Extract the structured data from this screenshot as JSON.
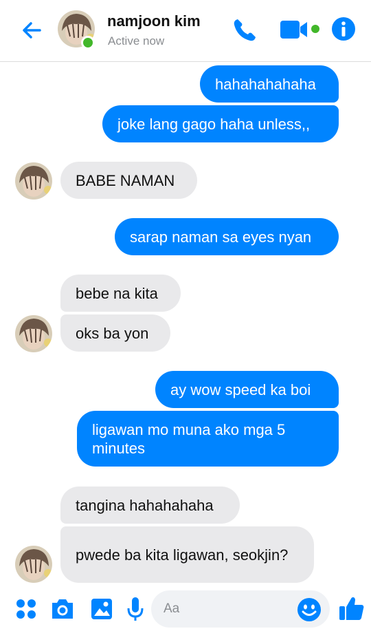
{
  "header": {
    "contact_name": "namjoon kim",
    "status": "Active now",
    "accent": "#0084ff",
    "online_color": "#42b72a",
    "icons": [
      "back-arrow-icon",
      "phone-icon",
      "video-camera-icon",
      "info-icon"
    ]
  },
  "messages": [
    {
      "from": "me",
      "text": "hahahahahaha"
    },
    {
      "from": "me",
      "text": "joke lang gago haha unless,,"
    },
    {
      "from": "them",
      "text": "BABE NAMAN"
    },
    {
      "from": "me",
      "text": "sarap naman sa eyes nyan"
    },
    {
      "from": "them",
      "text": "bebe na kita"
    },
    {
      "from": "them",
      "text": "oks ba yon"
    },
    {
      "from": "me",
      "text": "ay wow speed ka boi"
    },
    {
      "from": "me",
      "text": "ligawan mo muna ako mga 5 minutes"
    },
    {
      "from": "them",
      "text": "tangina hahahahaha"
    },
    {
      "from": "them",
      "text": "pwede ba kita ligawan, seokjin?"
    }
  ],
  "composer": {
    "placeholder": "Aa",
    "icons": [
      "apps-grid-icon",
      "camera-icon",
      "gallery-icon",
      "microphone-icon",
      "emoji-icon",
      "thumbs-up-icon"
    ]
  },
  "colors": {
    "outgoing_bubble": "#0084ff",
    "incoming_bubble": "#e9e9eb"
  }
}
